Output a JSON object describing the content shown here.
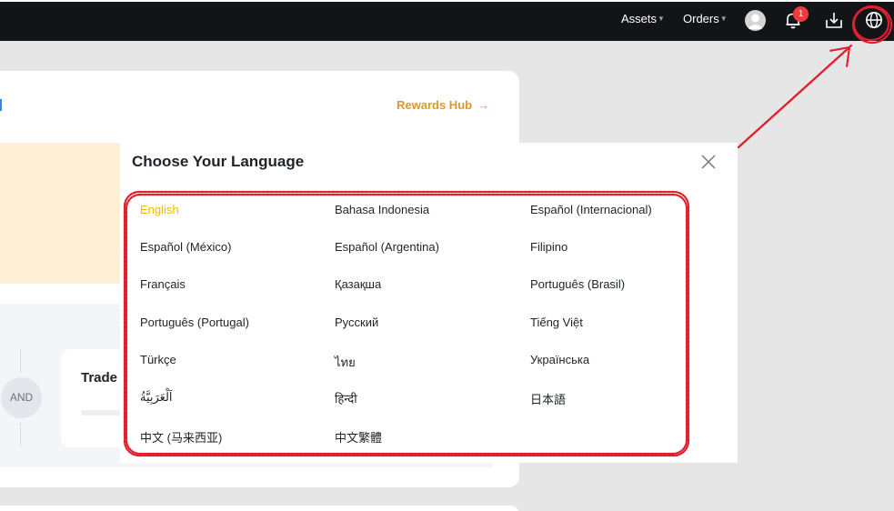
{
  "topbar": {
    "assets_label": "Assets",
    "orders_label": "Orders",
    "notification_count": "1",
    "icons": [
      "avatar",
      "bell-icon",
      "download-icon",
      "globe-icon"
    ]
  },
  "background": {
    "rewards_label": "Rewards Hub",
    "and_label": "AND",
    "trade_label": "Trade"
  },
  "modal": {
    "title": "Choose Your Language",
    "languages": [
      "English",
      "Bahasa Indonesia",
      "Español (Internacional)",
      "Español (México)",
      "Español (Argentina)",
      "Filipino",
      "Français",
      "Қазақша",
      "Português (Brasil)",
      "Português (Portugal)",
      "Русский",
      "Tiếng Việt",
      "Türkçe",
      "ไทย",
      "Українська",
      "اَلْعَرَبِيَّةُ",
      "हिन्दी",
      "日本語",
      "中文 (马来西亚)",
      "中文繁體"
    ],
    "selected": "English"
  },
  "colors": {
    "topbar_bg": "#121417",
    "accent": "#f0b90b",
    "rewards": "#dc9a25",
    "badge": "#f23a3a",
    "annotation": "#e0202e"
  }
}
